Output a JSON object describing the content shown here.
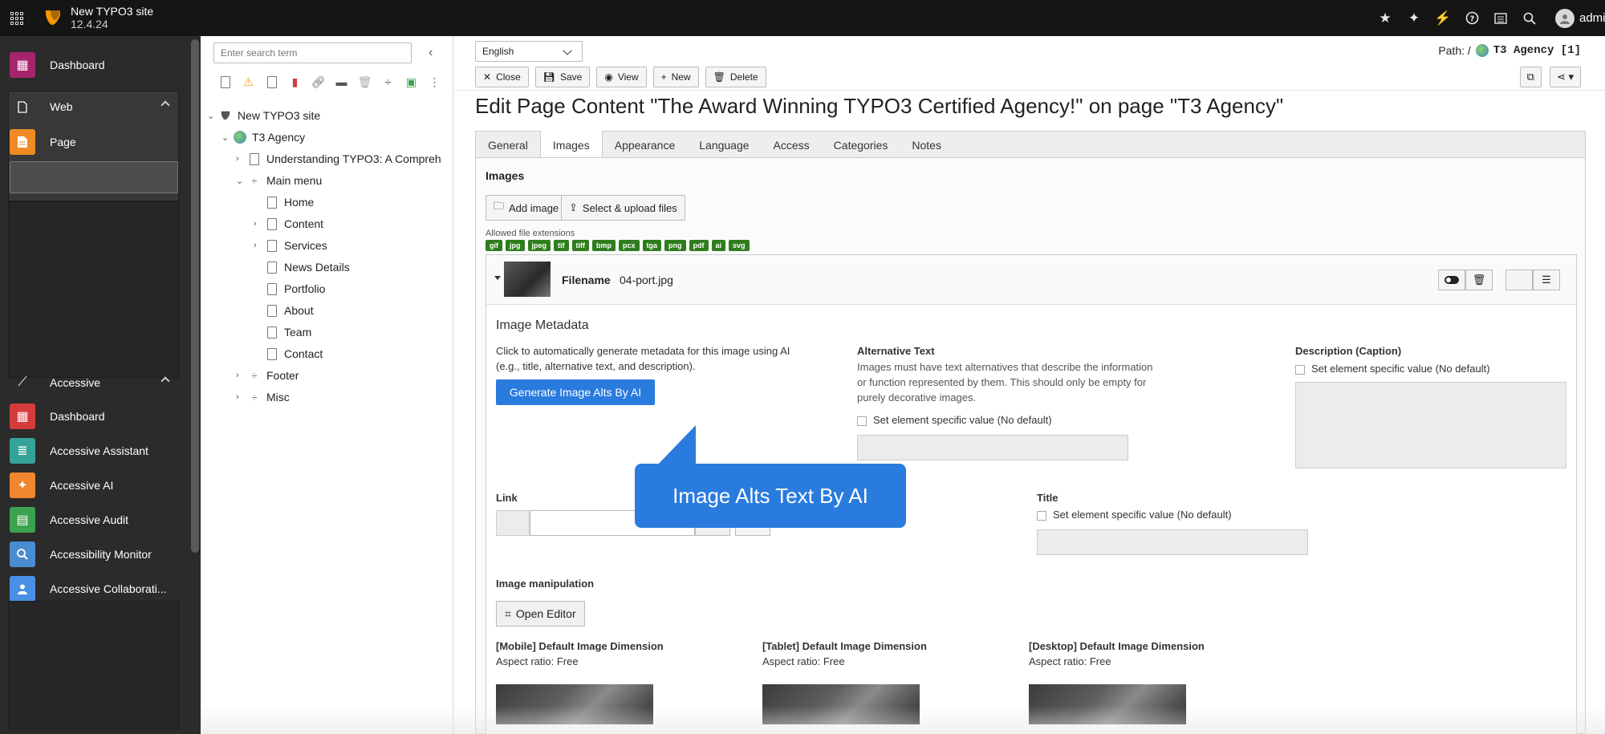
{
  "topbar": {
    "site_name": "New TYPO3 site",
    "version": "12.4.24",
    "user": "admin",
    "icons": [
      "star-icon",
      "sparkle-icon",
      "bolt-icon",
      "help-icon",
      "list-icon",
      "search-icon",
      "user-icon"
    ]
  },
  "modules": {
    "dashboard": "Dashboard",
    "web_group": "Web",
    "page": "Page",
    "accessive_group": "Accessive",
    "accessive_items": [
      "Dashboard",
      "Accessive Assistant",
      "Accessive AI",
      "Accessive Audit",
      "Accessibility Monitor",
      "Accessive Collaborati..."
    ],
    "colors": {
      "dashboard": "#a5246b",
      "page": "#f08a24",
      "red": "#d43b3b",
      "teal": "#35a29a",
      "orange": "#f0862e",
      "green": "#3ba34f",
      "blue": "#4a8cd1",
      "blue2": "#4a8fe6"
    }
  },
  "tree": {
    "search_placeholder": "Enter search term",
    "root": "New TYPO3 site",
    "agency": "T3 Agency",
    "understanding": "Understanding TYPO3: A Compreh",
    "main_menu": "Main menu",
    "children": [
      "Home",
      "Content",
      "Services",
      "News Details",
      "Portfolio",
      "About",
      "Team",
      "Contact"
    ],
    "footer": "Footer",
    "misc": "Misc"
  },
  "header": {
    "language": "English",
    "path_label": "Path: /",
    "path_page": "T3 Agency [1]",
    "buttons": {
      "close": "Close",
      "save": "Save",
      "view": "View",
      "new": "New",
      "delete": "Delete"
    }
  },
  "title": "Edit Page Content \"The Award Winning TYPO3 Certified Agency!\" on page \"T3 Agency\"",
  "tabs": [
    "General",
    "Images",
    "Appearance",
    "Language",
    "Access",
    "Categories",
    "Notes"
  ],
  "images": {
    "section": "Images",
    "add_image": "Add image",
    "select_upload": "Select & upload files",
    "allowed_label": "Allowed file extensions",
    "extensions": [
      "gif",
      "jpg",
      "jpeg",
      "tif",
      "tiff",
      "bmp",
      "pcx",
      "tga",
      "png",
      "pdf",
      "ai",
      "svg"
    ],
    "filename_label": "Filename",
    "filename": "04-port.jpg"
  },
  "metadata": {
    "title": "Image Metadata",
    "desc_line1": "Click to automatically generate metadata for this image using AI",
    "desc_line2": "(e.g., title, alternative text, and description).",
    "button": "Generate Image Alts By AI",
    "alt_label": "Alternative Text",
    "alt_help": [
      "Images must have text alternatives that describe the information",
      "or function represented by them. This should only be empty for",
      "purely decorative images."
    ],
    "alt_check": "Set element specific value (No default)",
    "caption_label": "Description (Caption)",
    "caption_check": "Set element specific value (No default)"
  },
  "callout": "Image Alts Text By AI",
  "link_label": "Link",
  "title_label": "Title",
  "title_check": "Set element specific value (No default)",
  "manip": {
    "label": "Image manipulation",
    "editor": "Open Editor",
    "mobile": "[Mobile] Default Image Dimension",
    "tablet": "[Tablet] Default Image Dimension",
    "desktop": "[Desktop] Default Image Dimension",
    "aspect": "Aspect ratio: Free"
  }
}
